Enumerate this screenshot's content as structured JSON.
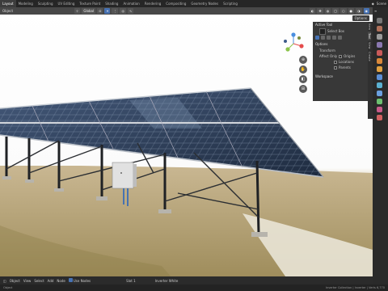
{
  "topbar": {
    "tabs": [
      "Layout",
      "Modeling",
      "Sculpting",
      "UV Editing",
      "Texture Paint",
      "Shading",
      "Animation",
      "Rendering",
      "Compositing",
      "Geometry Nodes",
      "Scripting"
    ],
    "scene_label": "Scene"
  },
  "viewport": {
    "mode_label": "Object",
    "orientation_label": "Global",
    "options_label": "Options"
  },
  "npanel": {
    "active_tool_label": "Active Tool",
    "select_box_label": "Select Box",
    "options_label": "Options",
    "transform_label": "Transform",
    "affect_only_label": "Affect Only",
    "origins_label": "Origins",
    "locations_label": "Locations",
    "parents_label": "Parents",
    "workspace_label": "Workspace",
    "tabs": [
      "Item",
      "Tool",
      "View",
      "Create"
    ]
  },
  "footer": {
    "object_label": "Object",
    "view_label": "View",
    "select_label": "Select",
    "add_label": "Add",
    "node_label": "Node",
    "use_nodes_label": "Use Nodes",
    "slot_label": "Slot 1",
    "material_label": "Inverter White"
  },
  "status": {
    "left": "Object",
    "right": "Inverter Collection | Inverter | Verts 6,770"
  },
  "colors": {
    "accent": "#4772b3",
    "axis_x": "#e54b4b",
    "axis_y": "#8bc34a",
    "axis_z": "#4a8fe0"
  }
}
